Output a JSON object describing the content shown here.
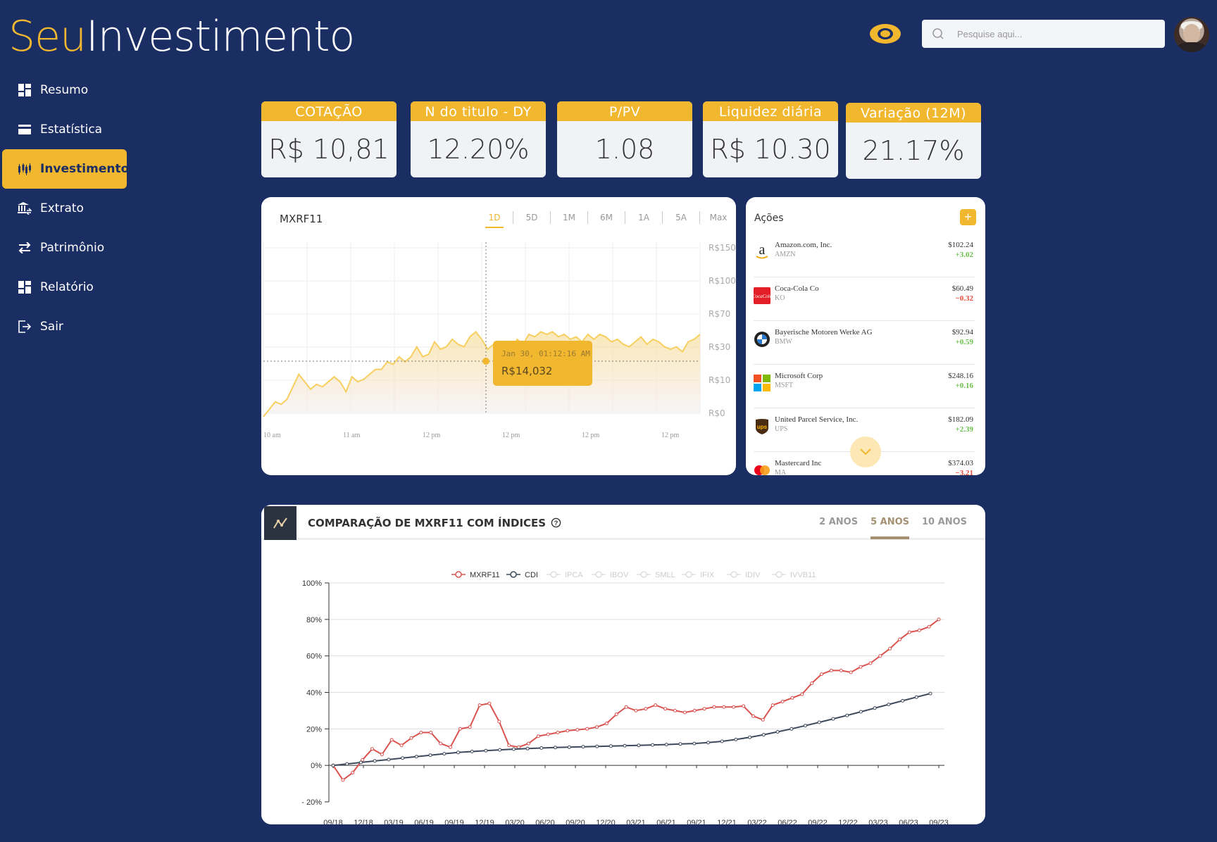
{
  "brand": {
    "part1": "Seu",
    "part2": "Investimento"
  },
  "search": {
    "placeholder": "Pesquise aqui..."
  },
  "nav": [
    {
      "label": "Resumo",
      "icon": "dashboard-icon"
    },
    {
      "label": "Estatística",
      "icon": "card-icon"
    },
    {
      "label": "Investimentos",
      "icon": "candlestick-icon",
      "active": true
    },
    {
      "label": "Extrato",
      "icon": "bank-icon"
    },
    {
      "label": "Patrimônio",
      "icon": "swap-icon"
    },
    {
      "label": "Relatório",
      "icon": "dashboard-icon"
    },
    {
      "label": "Sair",
      "icon": "logout-icon"
    }
  ],
  "kpis": [
    {
      "label": "COTAÇÃO",
      "value": "R$ 10,81"
    },
    {
      "label": "N do titulo - DY",
      "value": "12.20%"
    },
    {
      "label": "P/PV",
      "value": "1.08"
    },
    {
      "label": "Liquidez diária",
      "value": "R$ 10.30"
    },
    {
      "label": "Variação (12M)",
      "value": "21.17%"
    }
  ],
  "price_chart": {
    "title": "MXRF11",
    "ranges": [
      "1D",
      "5D",
      "1M",
      "6M",
      "1A",
      "5A",
      "Max"
    ],
    "active_range": "1D",
    "tooltip": {
      "time": "Jan 30, 01:12:16 AM",
      "value": "R$14,032"
    }
  },
  "stocks": {
    "title": "Ações",
    "add_label": "+",
    "items": [
      {
        "name": "Amazon.com, Inc.",
        "ticker": "AMZN",
        "price": "$102.24",
        "change": "+3.02",
        "dir": "up",
        "logo": "amazon-logo"
      },
      {
        "name": "Coca-Cola Co",
        "ticker": "KO",
        "price": "$60.49",
        "change": "−0.32",
        "dir": "dn",
        "logo": "coca-cola-logo"
      },
      {
        "name": "Bayerische Motoren Werke AG",
        "ticker": "BMW",
        "price": "$92.94",
        "change": "+0.59",
        "dir": "up",
        "logo": "bmw-logo"
      },
      {
        "name": "Microsoft Corp",
        "ticker": "MSFT",
        "price": "$248.16",
        "change": "+0.16",
        "dir": "up",
        "logo": "microsoft-logo"
      },
      {
        "name": "United Parcel Service, Inc.",
        "ticker": "UPS",
        "price": "$182.09",
        "change": "+2.39",
        "dir": "up",
        "logo": "ups-logo"
      },
      {
        "name": "Mastercard Inc",
        "ticker": "MA",
        "price": "$374.03",
        "change": "−3.21",
        "dir": "dn",
        "logo": "mastercard-logo"
      }
    ]
  },
  "comparison": {
    "title": "COMPARAÇÃO DE MXRF11 COM ÍNDICES",
    "tabs": [
      "2 ANOS",
      "5 ANOS",
      "10 ANOS"
    ],
    "active_tab": "5 ANOS"
  },
  "colors": {
    "accent": "#f0b72f",
    "background": "#1a2e63",
    "up": "#6cc04a",
    "down": "#e74c3c",
    "mxrf_line": "#d9534f",
    "cdi_line": "#3d4a5c"
  },
  "chart_data": [
    {
      "type": "area",
      "title": "MXRF11",
      "x": [
        "10 am",
        "11 am",
        "12 pm",
        "12 pm",
        "12 pm",
        "12 pm"
      ],
      "y_ticks": [
        "R$150",
        "R$100",
        "R$70",
        "R$30",
        "R$10",
        "R$0"
      ],
      "series": [
        {
          "values": [
            0,
            3,
            6,
            5,
            7,
            12,
            17,
            14,
            11,
            13,
            12,
            14,
            16,
            14,
            10,
            16,
            14,
            15,
            17,
            19,
            19,
            22,
            21,
            24,
            22,
            24,
            28,
            24,
            25,
            30,
            27,
            28,
            31,
            29,
            28,
            32,
            34,
            31,
            27,
            29,
            30,
            27,
            26,
            31,
            29,
            33,
            32,
            34,
            33,
            34,
            32,
            33,
            31,
            32,
            30,
            33,
            31,
            33,
            32,
            30,
            31,
            29,
            28,
            30,
            32,
            29,
            31,
            30,
            28,
            27,
            28,
            26,
            30,
            31,
            33
          ]
        }
      ]
    },
    {
      "type": "line",
      "title": "COMPARAÇÃO DE MXRF11 COM ÍNDICES",
      "legend": [
        "MXRF11",
        "CDI",
        "IPCA",
        "IBOV",
        "SMLL",
        "IFIX",
        "IDIV",
        "IVVB11"
      ],
      "legend_active": [
        "MXRF11",
        "CDI"
      ],
      "x": [
        "09/18",
        "12/18",
        "03/19",
        "06/19",
        "09/19",
        "12/19",
        "03/20",
        "06/20",
        "09/20",
        "12/20",
        "03/21",
        "06/21",
        "09/21",
        "12/21",
        "03/22",
        "06/22",
        "09/22",
        "12/22",
        "03/23",
        "06/23",
        "09/23"
      ],
      "y_ticks": [
        "- 20%",
        "0%",
        "20%",
        "40%",
        "60%",
        "80%",
        "100%"
      ],
      "ylim": [
        -20,
        100
      ],
      "series": [
        {
          "name": "MXRF11",
          "values": [
            0,
            -8,
            -4,
            3,
            9,
            6,
            14,
            11,
            15,
            18,
            18,
            12,
            10,
            20,
            21,
            33,
            34,
            24,
            11,
            10,
            12,
            16,
            17,
            18,
            19,
            19.5,
            20,
            21,
            23,
            28,
            32,
            30,
            31,
            33,
            31,
            30,
            29,
            30,
            31,
            32,
            32,
            32,
            32.5,
            27,
            25,
            33,
            35,
            37,
            39,
            45,
            50,
            52,
            52,
            51,
            54,
            56,
            60,
            64,
            69,
            73,
            74,
            76,
            80
          ]
        },
        {
          "name": "CDI",
          "values": [
            0,
            0.8,
            1.6,
            2.4,
            3.2,
            4,
            4.8,
            5.6,
            6.4,
            7.1,
            7.6,
            8.1,
            8.5,
            8.9,
            9.2,
            9.5,
            9.8,
            10,
            10.2,
            10.4,
            10.6,
            10.8,
            11,
            11.2,
            11.4,
            11.7,
            12,
            12.5,
            13.2,
            14.2,
            15.4,
            16.8,
            18.4,
            20,
            21.8,
            23.6,
            25.5,
            27.4,
            29.4,
            31.4,
            33.4,
            35.4,
            37.4,
            39.4
          ]
        }
      ]
    }
  ]
}
